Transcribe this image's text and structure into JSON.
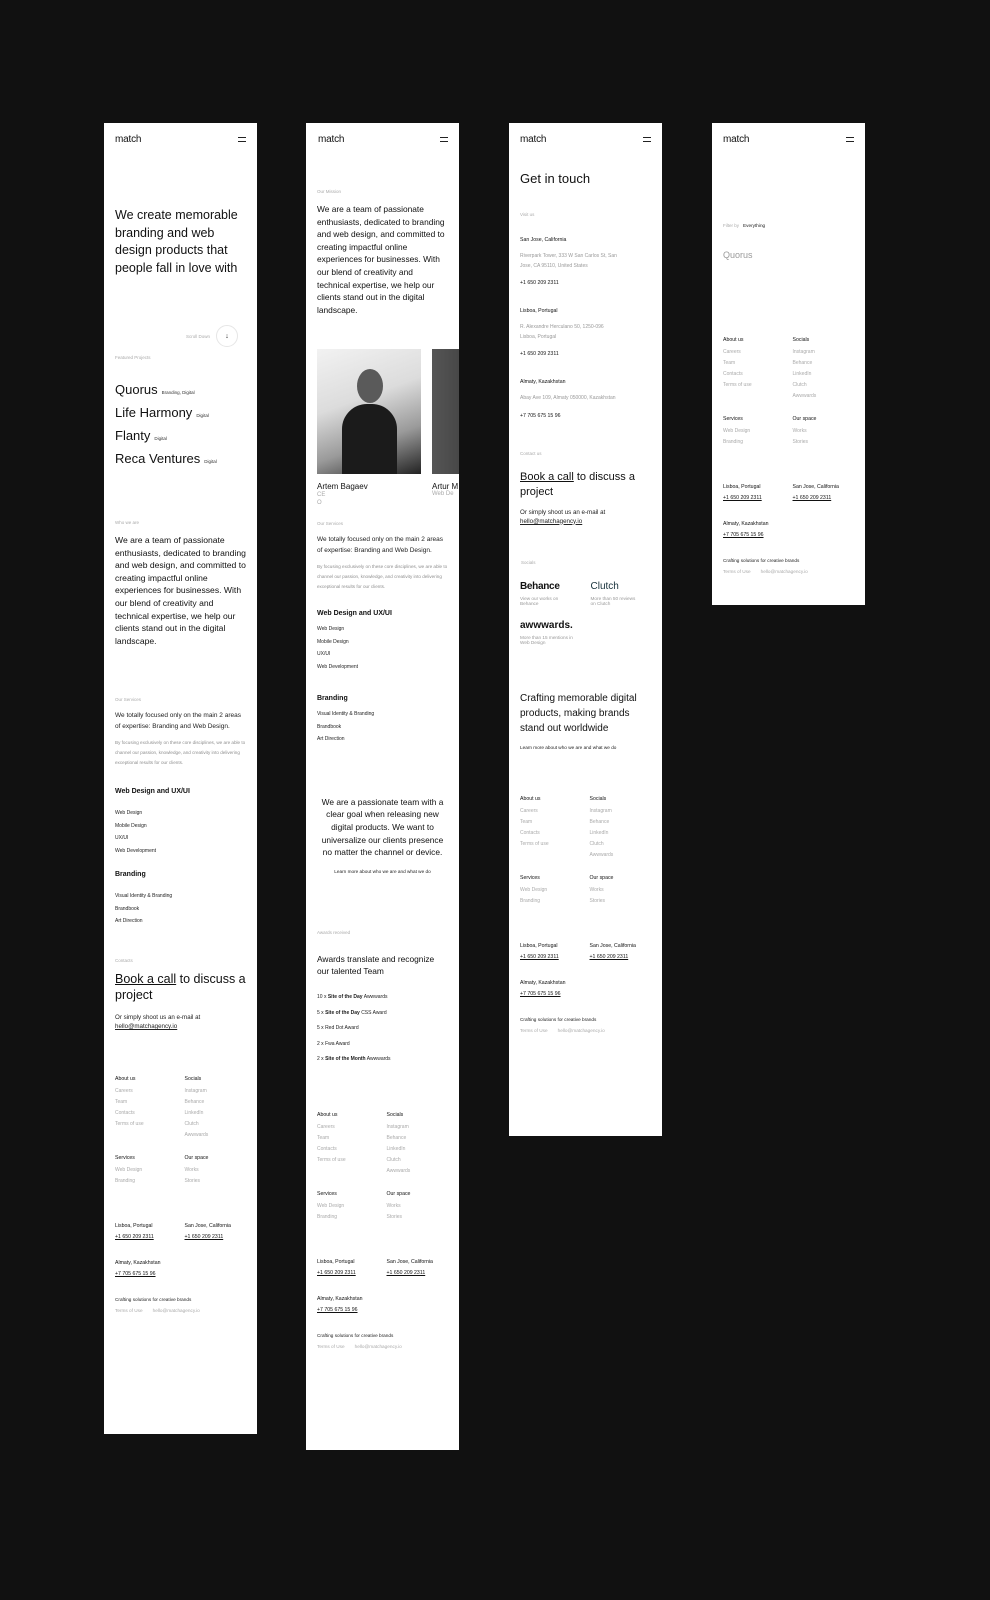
{
  "brand": "match",
  "panel1": {
    "hero": "We create memorable branding and web design products that people fall in love with",
    "scroll_label": "Scroll Down",
    "scroll_icon": "arrow-down-icon",
    "featured_label": "Featured Projects",
    "projects": [
      {
        "name": "Quorus",
        "tags": "Branding, Digital"
      },
      {
        "name": "Life Harmony",
        "tags": "Digital"
      },
      {
        "name": "Flanty",
        "tags": "Digital"
      },
      {
        "name": "Reca Ventures",
        "tags": "Digital"
      }
    ],
    "who_label": "Who we are",
    "who_text": "We are a team of passionate enthusiasts, dedicated to branding and web design, and committed to creating impactful online experiences for businesses. With our blend of creativity and technical expertise, we help our clients stand out in the digital landscape.",
    "services_label": "Our Services",
    "services_lead": "We totally focused only on the main 2 areas of expertise: Branding and Web Design.",
    "services_desc": "By focusing exclusively on these core disciplines, we are able to channel our passion, knowledge, and creativity into delivering exceptional results for our clients.",
    "group1_title": "Web Design and UX/UI",
    "group1_items": [
      "Web Design",
      "Mobile Design",
      "UX/UI",
      "Web Development"
    ],
    "group2_title": "Branding",
    "group2_items": [
      "Visual Identity & Branding",
      "Brandbook",
      "Art Direction"
    ],
    "contacts_label": "Contacts",
    "cta_link": "Book a call",
    "cta_rest": " to discuss a project",
    "email_lead": "Or simply shoot us an e-mail at",
    "email": "hello@matchagency.io"
  },
  "panel2": {
    "mission_label": "Our Mission",
    "mission_text": "We are a team of passionate enthusiasts, dedicated to branding and web design, and committed to creating impactful online experiences for businesses. With our blend of creativity and technical expertise, we help our clients stand out in the digital landscape.",
    "team": [
      {
        "name": "Artem Bagaev",
        "role": "CEO"
      },
      {
        "name": "Artur M",
        "role": "Web De"
      }
    ],
    "services_label": "Our Services",
    "services_lead": "We totally focused only on the main 2 areas of expertise: Branding and Web Design.",
    "services_desc": "By focusing exclusively on these core disciplines, we are able to channel our passion, knowledge, and creativity into delivering exceptional results for our clients.",
    "group1_title": "Web Design and UX/UI",
    "group1_items": [
      "Web Design",
      "Mobile Design",
      "UX/UI",
      "Web Development"
    ],
    "group2_title": "Branding",
    "group2_items": [
      "Visual Identity & Branding",
      "Brandbook",
      "Art Direction"
    ],
    "statement": "We are a passionate team with a clear goal when releasing new digital products. We want to universalize our clients presence no matter the channel or device.",
    "learn_more": "Learn more about who we are and what we do",
    "awards_label": "Awards received",
    "awards_title": "Awards translate and recognize our talented Team",
    "awards": [
      {
        "count": "10 x",
        "bold": "Site of the Day",
        "rest": "Awwwards"
      },
      {
        "count": "5 x",
        "bold": "Site of the Day",
        "rest": "CSS Award"
      },
      {
        "count": "5 x",
        "bold": "",
        "rest": "Red Dot Award"
      },
      {
        "count": "2 x",
        "bold": "",
        "rest": "Fwa Award"
      },
      {
        "count": "2 x",
        "bold": "Site of the Month",
        "rest": "Awwwards"
      }
    ]
  },
  "panel3": {
    "title": "Get in touch",
    "visit_label": "Visit us",
    "offices": [
      {
        "city": "San Jose, California",
        "address": "Riverpark Tower, 333 W San Carlos St, San Jose, CA 95110, United States",
        "phone": "+1 650 209 2311"
      },
      {
        "city": "Lisboa, Portugal",
        "address": "R. Alexandre Herculano 50, 1250-096 Lisboa, Portugal",
        "phone": "+1 650 209 2311"
      },
      {
        "city": "Almaty, Kazakhstan",
        "address": "Abay Ave 109, Almaty 050000, Kazakhstan",
        "phone": "+7 705 675 15 96"
      }
    ],
    "contact_label": "Contact us",
    "cta_link": "Book a call",
    "cta_rest": " to discuss a project",
    "email_lead": "Or simply shoot us an e-mail at",
    "email": "hello@matchagency.io",
    "socials_label": "Socials",
    "socials": [
      {
        "name": "Behance",
        "desc": "View our works on Behance"
      },
      {
        "name": "Clutch",
        "desc": "More than 50 reviews on Clutch"
      },
      {
        "name": "awwwards.",
        "desc": "More than 15 mentions in Web Design"
      }
    ],
    "statement": "Crafting memorable digital products, making brands stand out worldwide",
    "learn_more": "Learn more about who we are and what we do"
  },
  "panel4": {
    "filter_label": "Filter by",
    "filter_value": "Everything",
    "project": "Quorus"
  },
  "footer": {
    "about_title": "About us",
    "about_items": [
      "Careers",
      "Team",
      "Contacts",
      "Terms of use"
    ],
    "socials_title": "Socials",
    "socials_items": [
      "Instagram",
      "Behance",
      "LinkedIn",
      "Clutch",
      "Awwwards"
    ],
    "services_title": "Services",
    "services_items": [
      "Web Design",
      "Branding"
    ],
    "space_title": "Our space",
    "space_items": [
      "Works",
      "Stories"
    ],
    "offices": [
      {
        "city": "Lisboa, Portugal",
        "phone": "+1 650 209 2311"
      },
      {
        "city": "San Jose, California",
        "phone": "+1 650 209 2311"
      },
      {
        "city": "Almaty, Kazakhstan",
        "phone": "+7 705 675 15 96"
      }
    ],
    "tagline": "Crafting solutions for creative brands",
    "terms": "Terms of Use",
    "email": "hello@matchagency.io"
  }
}
